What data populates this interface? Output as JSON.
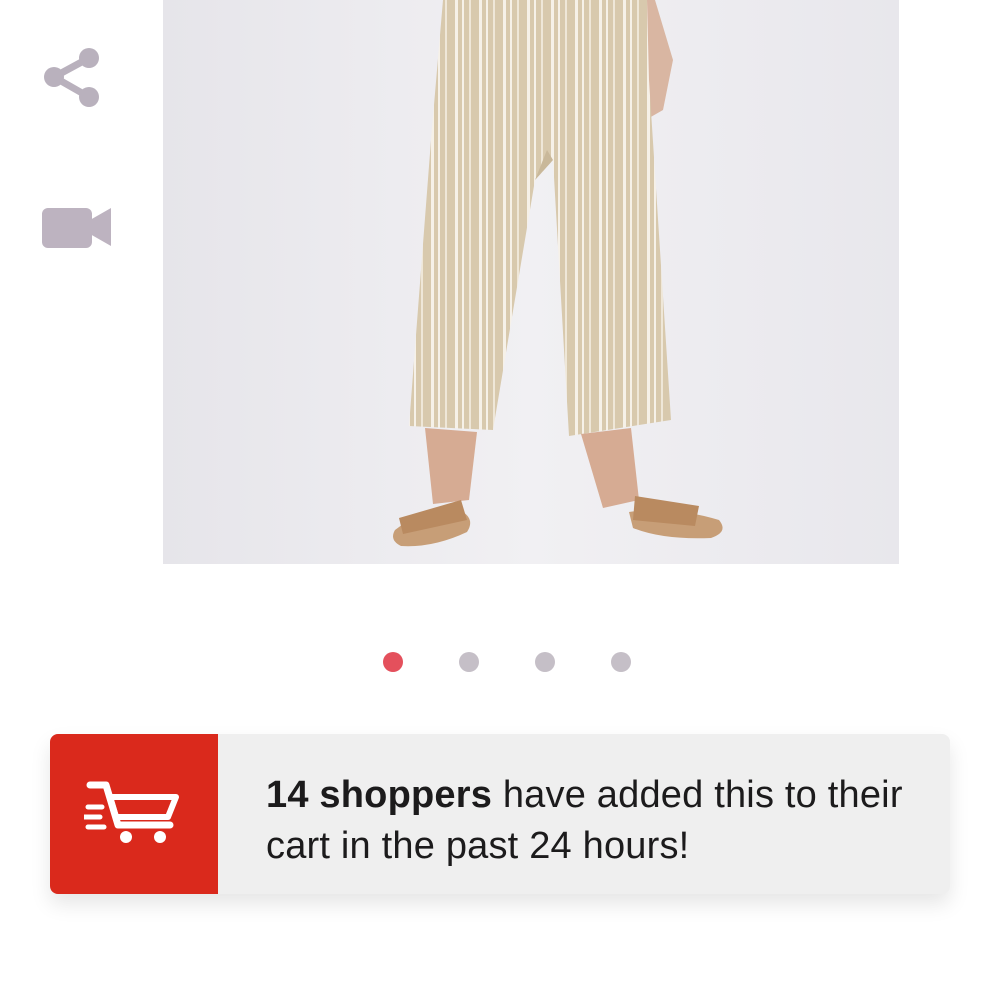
{
  "actions": {
    "share_icon": "share-icon",
    "video_icon": "video-camera-icon"
  },
  "product_image": {
    "icon": "product-photo",
    "description_alt": ""
  },
  "carousel": {
    "total": 4,
    "active_index": 0,
    "active_color": "#e4505c",
    "inactive_color": "#c5bfc7"
  },
  "cart_banner": {
    "icon": "shopping-cart-icon",
    "accent_color": "#da291c",
    "highlight": "14 shoppers",
    "message_rest": " have added this to their cart in the past 24 hours!"
  }
}
